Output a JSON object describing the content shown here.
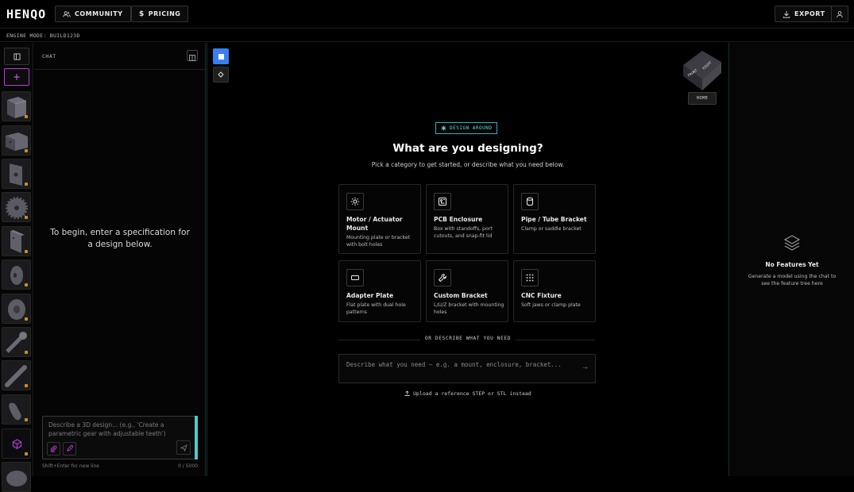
{
  "header": {
    "logo": "HENQO",
    "community_label": "COMMUNITY",
    "pricing_label": "PRICING",
    "export_label": "EXPORT"
  },
  "modebar": {
    "text": "ENGINE MODE: BUILD123D"
  },
  "chat": {
    "title": "CHAT",
    "empty_message": "To begin, enter a specification for a design below.",
    "input_placeholder": "Describe a 3D design... (e.g., 'Create a parametric gear with adjustable teeth')",
    "hint": "Shift+Enter for new line",
    "counter": "0 / 5000"
  },
  "viewer": {
    "home_label": "HOME",
    "cube_faces": [
      "FRONT",
      "RIGHT"
    ]
  },
  "main": {
    "badge": "DESIGN AROUND",
    "heading": "What are you designing?",
    "subheading": "Pick a category to get started, or describe what you need below.",
    "cards": [
      {
        "title": "Motor / Actuator Mount",
        "desc": "Mounting plate or bracket with bolt holes",
        "icon": "gear-icon"
      },
      {
        "title": "PCB Enclosure",
        "desc": "Box with standoffs, port cutouts, and snap-fit lid",
        "icon": "circuit-board-icon"
      },
      {
        "title": "Pipe / Tube Bracket",
        "desc": "Clamp or saddle bracket",
        "icon": "cylinder-icon"
      },
      {
        "title": "Adapter Plate",
        "desc": "Flat plate with dual hole patterns",
        "icon": "plate-icon"
      },
      {
        "title": "Custom Bracket",
        "desc": "L/U/Z bracket with mounting holes",
        "icon": "wrench-icon"
      },
      {
        "title": "CNC Fixture",
        "desc": "Soft jaws or clamp plate",
        "icon": "grid-dots-icon"
      }
    ],
    "or_label": "OR DESCRIBE WHAT YOU NEED",
    "describe_placeholder": "Describe what you need — e.g. a mount, enclosure, bracket...",
    "upload_label": "Upload a reference STEP or STL instead"
  },
  "features": {
    "title": "No Features Yet",
    "subtitle": "Generate a model using the chat to see the feature tree here"
  },
  "colors": {
    "accent_cyan": "#2ab6bf",
    "accent_blue": "#3a7ff2",
    "accent_magenta": "#b53ce0"
  }
}
